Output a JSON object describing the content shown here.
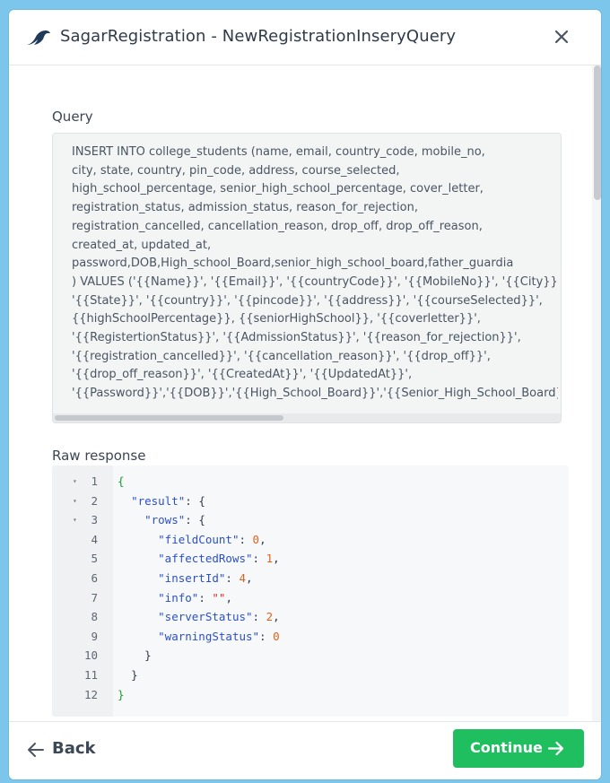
{
  "window": {
    "title": "SagarRegistration - NewRegistrationInseryQuery",
    "logo_icon": "bird-logo-icon",
    "close_icon": "close-icon"
  },
  "query": {
    "label": "Query",
    "text": "INSERT INTO college_students (name, email, country_code, mobile_no,\ncity, state, country, pin_code, address, course_selected,\nhigh_school_percentage, senior_high_school_percentage, cover_letter,\nregistration_status, admission_status, reason_for_rejection,\nregistration_cancelled, cancellation_reason, drop_off, drop_off_reason,\ncreated_at, updated_at,\npassword,DOB,High_school_Board,senior_high_school_board,father_guardia\n) VALUES ('{{Name}}', '{{Email}}', '{{countryCode}}', '{{MobileNo}}', '{{City}}',\n'{{State}}', '{{country}}', '{{pincode}}', '{{address}}', '{{courseSelected}}',\n{{highSchoolPercentage}}, {{seniorHighSchool}}, '{{coverletter}}',\n'{{RegistertionStatus}}', '{{AdmissionStatus}}', '{{reason_for_rejection}}',\n'{{registration_cancelled}}', '{{cancellation_reason}}', '{{drop_off}}',\n'{{drop_off_reason}}', '{{CreatedAt}}', '{{UpdatedAt}}',\n'{{Password}}','{{DOB}}','{{High_School_Board}}','{{Senior_High_School_Board}}"
  },
  "raw_response": {
    "label": "Raw response",
    "lines": [
      {
        "n": "1",
        "fold": true,
        "indent": "",
        "parts": [
          {
            "t": "{",
            "c": "brace"
          }
        ]
      },
      {
        "n": "2",
        "fold": true,
        "indent": "  ",
        "parts": [
          {
            "t": "\"result\"",
            "c": "key"
          },
          {
            "t": ": {",
            "c": "punc"
          }
        ]
      },
      {
        "n": "3",
        "fold": true,
        "indent": "    ",
        "parts": [
          {
            "t": "\"rows\"",
            "c": "key"
          },
          {
            "t": ": {",
            "c": "punc"
          }
        ]
      },
      {
        "n": "4",
        "fold": false,
        "indent": "      ",
        "parts": [
          {
            "t": "\"fieldCount\"",
            "c": "key"
          },
          {
            "t": ": ",
            "c": "punc"
          },
          {
            "t": "0",
            "c": "num"
          },
          {
            "t": ",",
            "c": "punc"
          }
        ]
      },
      {
        "n": "5",
        "fold": false,
        "indent": "      ",
        "parts": [
          {
            "t": "\"affectedRows\"",
            "c": "key"
          },
          {
            "t": ": ",
            "c": "punc"
          },
          {
            "t": "1",
            "c": "num"
          },
          {
            "t": ",",
            "c": "punc"
          }
        ]
      },
      {
        "n": "6",
        "fold": false,
        "indent": "      ",
        "parts": [
          {
            "t": "\"insertId\"",
            "c": "key"
          },
          {
            "t": ": ",
            "c": "punc"
          },
          {
            "t": "4",
            "c": "num"
          },
          {
            "t": ",",
            "c": "punc"
          }
        ]
      },
      {
        "n": "7",
        "fold": false,
        "indent": "      ",
        "parts": [
          {
            "t": "\"info\"",
            "c": "key"
          },
          {
            "t": ": ",
            "c": "punc"
          },
          {
            "t": "\"\"",
            "c": "str"
          },
          {
            "t": ",",
            "c": "punc"
          }
        ]
      },
      {
        "n": "8",
        "fold": false,
        "indent": "      ",
        "parts": [
          {
            "t": "\"serverStatus\"",
            "c": "key"
          },
          {
            "t": ": ",
            "c": "punc"
          },
          {
            "t": "2",
            "c": "num"
          },
          {
            "t": ",",
            "c": "punc"
          }
        ]
      },
      {
        "n": "9",
        "fold": false,
        "indent": "      ",
        "parts": [
          {
            "t": "\"warningStatus\"",
            "c": "key"
          },
          {
            "t": ": ",
            "c": "punc"
          },
          {
            "t": "0",
            "c": "num"
          }
        ]
      },
      {
        "n": "10",
        "fold": false,
        "indent": "    ",
        "parts": [
          {
            "t": "}",
            "c": "punc"
          }
        ]
      },
      {
        "n": "11",
        "fold": false,
        "indent": "  ",
        "parts": [
          {
            "t": "}",
            "c": "punc"
          }
        ]
      },
      {
        "n": "12",
        "fold": false,
        "indent": "",
        "parts": [
          {
            "t": "}",
            "c": "brace"
          }
        ]
      }
    ]
  },
  "footer": {
    "back_label": "Back",
    "back_icon": "arrow-left-icon",
    "continue_label": "Continue",
    "continue_icon": "arrow-right-icon"
  },
  "colors": {
    "accent_green": "#1fbf5f",
    "backdrop": "#7cc6ec",
    "logo": "#1f3b5a"
  }
}
